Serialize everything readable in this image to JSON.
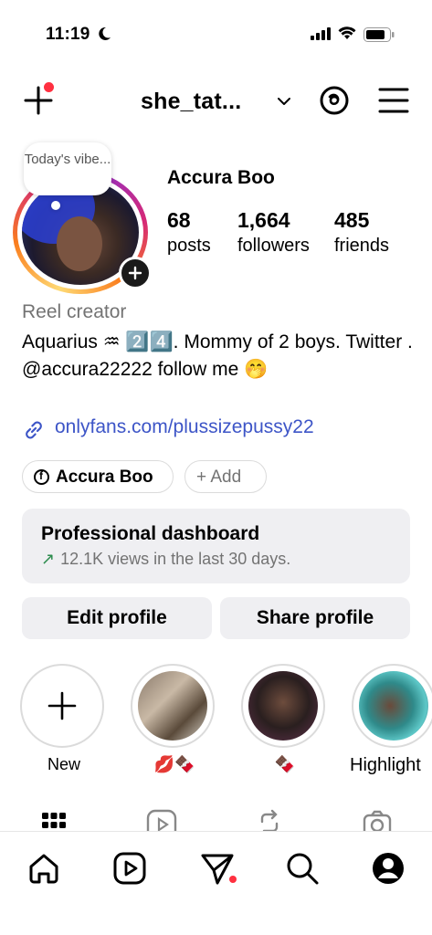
{
  "status_bar": {
    "time": "11:19"
  },
  "header": {
    "username": "she_tat..."
  },
  "profile": {
    "note": "Today's vibe...",
    "display_name": "Accura Boo",
    "stats": [
      {
        "value": "68",
        "label": "posts"
      },
      {
        "value": "1,664",
        "label": "followers"
      },
      {
        "value": "485",
        "label": "friends"
      }
    ],
    "category": "Reel creator",
    "bio": "Aquarius ♒ 2️⃣4️⃣. Mommy of 2 boys. Twitter . @accura22222 follow me 🤭",
    "link": "onlyfans.com/plussizepussy22"
  },
  "chips": {
    "facebook": "Accura Boo",
    "add": "+ Add"
  },
  "dashboard": {
    "title": "Professional dashboard",
    "subtitle": "12.1K views in the last 30 days.",
    "arrow": "↗"
  },
  "buttons": {
    "edit": "Edit profile",
    "share": "Share profile"
  },
  "highlights": [
    {
      "label": "New"
    },
    {
      "label": "💋🍫"
    },
    {
      "label": "🍫"
    },
    {
      "label": "Highlight"
    }
  ],
  "colors": {
    "link": "#3d55c7",
    "notification_dot": "#ff3040",
    "growth_arrow": "#2d8c4e"
  }
}
